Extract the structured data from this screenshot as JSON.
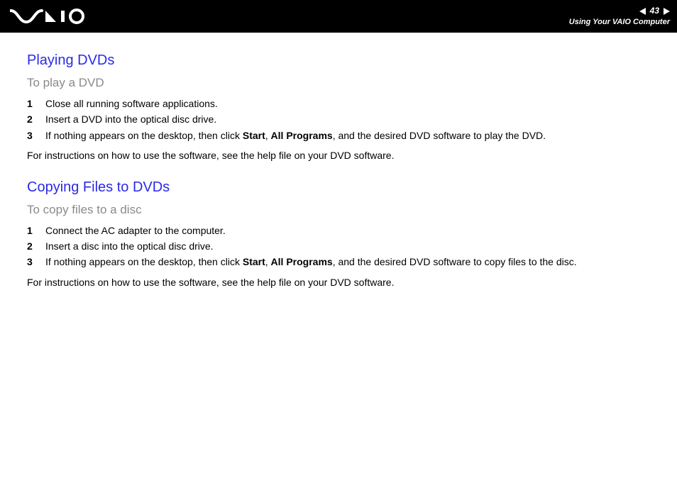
{
  "header": {
    "page_number": "43",
    "section": "Using Your VAIO Computer"
  },
  "sections": [
    {
      "title": "Playing DVDs",
      "subtitle": "To play a DVD",
      "steps": [
        {
          "num": "1",
          "plain": "Close all running software applications."
        },
        {
          "num": "2",
          "plain": "Insert a DVD into the optical disc drive."
        },
        {
          "num": "3",
          "pre": "If nothing appears on the desktop, then click ",
          "b1": "Start",
          "mid1": ", ",
          "b2": "All Programs",
          "post": ", and the desired DVD software to play the DVD."
        }
      ],
      "note": "For instructions on how to use the software, see the help file on your DVD software."
    },
    {
      "title": "Copying Files to DVDs",
      "subtitle": "To copy files to a disc",
      "steps": [
        {
          "num": "1",
          "plain": "Connect the AC adapter to the computer."
        },
        {
          "num": "2",
          "plain": "Insert a disc into the optical disc drive."
        },
        {
          "num": "3",
          "pre": "If nothing appears on the desktop, then click ",
          "b1": "Start",
          "mid1": ", ",
          "b2": "All Programs",
          "post": ", and the desired DVD software to copy files to the disc."
        }
      ],
      "note": "For instructions on how to use the software, see the help file on your DVD software."
    }
  ]
}
